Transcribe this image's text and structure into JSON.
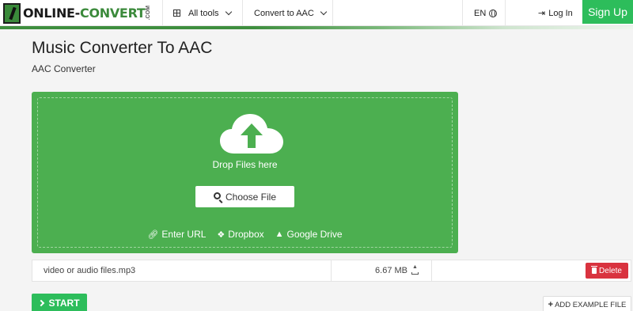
{
  "header": {
    "logo": {
      "text_main": "ONLINE-",
      "text_accent": "CONVERT",
      "text_small": ".COM"
    },
    "nav": {
      "all_tools_label": "All tools",
      "convert_to_label": "Convert to AAC",
      "language_label": "EN",
      "login_label": "Log In",
      "signup_label": "Sign Up"
    }
  },
  "page": {
    "title": "Music Converter To AAC",
    "subtitle": "AAC Converter"
  },
  "dropzone": {
    "drop_text": "Drop Files here",
    "choose_label": "Choose File",
    "sources": [
      {
        "label": "Enter URL",
        "icon": "link-icon"
      },
      {
        "label": "Dropbox",
        "icon": "dropbox-icon"
      },
      {
        "label": "Google Drive",
        "icon": "google-drive-icon"
      }
    ]
  },
  "file": {
    "name": "video or audio files.mp3",
    "size": "6.67 MB",
    "delete_label": "Delete"
  },
  "actions": {
    "start_label": "START",
    "example_label": "ADD EXAMPLE FILE"
  },
  "colors": {
    "brand_green": "#4caf50",
    "button_green": "#2dbd5b",
    "delete_red": "#d9333f"
  }
}
